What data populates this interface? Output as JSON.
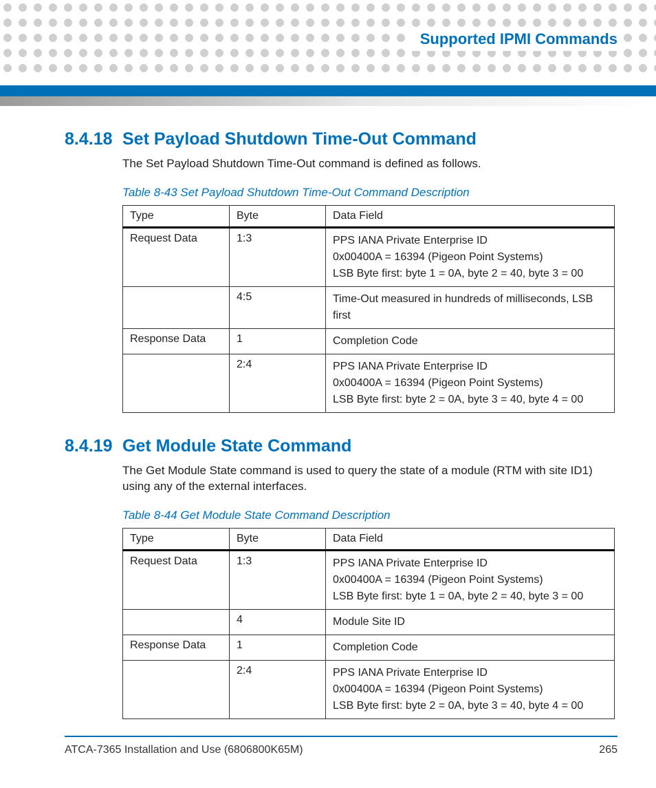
{
  "header": {
    "title": "Supported IPMI Commands"
  },
  "sections": [
    {
      "number": "8.4.18",
      "title": "Set Payload Shutdown Time-Out Command",
      "intro": "The Set Payload Shutdown Time-Out command is defined as follows.",
      "table_caption": "Table 8-43 Set Payload Shutdown Time-Out Command Description",
      "table": {
        "headers": [
          "Type",
          "Byte",
          "Data Field"
        ],
        "rows": [
          {
            "type": "Request Data",
            "byte": "1:3",
            "data": "PPS IANA Private Enterprise ID\n0x00400A = 16394 (Pigeon Point Systems)\nLSB Byte first: byte 1 = 0A, byte 2 = 40, byte 3 = 00"
          },
          {
            "type": "",
            "byte": "4:5",
            "data": "Time-Out measured in hundreds of milliseconds, LSB first"
          },
          {
            "type": "Response Data",
            "byte": "1",
            "data": "Completion Code"
          },
          {
            "type": "",
            "byte": "2:4",
            "data": "PPS IANA Private Enterprise ID\n0x00400A = 16394 (Pigeon Point Systems)\nLSB Byte first: byte 2 = 0A, byte 3 = 40, byte 4 = 00"
          }
        ]
      }
    },
    {
      "number": "8.4.19",
      "title": "Get Module State Command",
      "intro": "The Get Module State command is used to query the state of a module (RTM with site ID1) using any of the external interfaces.",
      "table_caption": "Table 8-44 Get Module State Command Description",
      "table": {
        "headers": [
          "Type",
          "Byte",
          "Data Field"
        ],
        "rows": [
          {
            "type": "Request Data",
            "byte": "1:3",
            "data": "PPS IANA Private Enterprise ID\n0x00400A = 16394 (Pigeon Point Systems)\nLSB Byte first: byte 1 = 0A, byte 2 = 40, byte 3 = 00"
          },
          {
            "type": "",
            "byte": "4",
            "data": "Module Site ID"
          },
          {
            "type": "Response Data",
            "byte": "1",
            "data": "Completion Code"
          },
          {
            "type": "",
            "byte": "2:4",
            "data": "PPS IANA Private Enterprise ID\n0x00400A = 16394 (Pigeon Point Systems)\nLSB Byte first: byte 2 = 0A, byte 3 = 40, byte 4 = 00"
          }
        ]
      }
    }
  ],
  "footer": {
    "doc": "ATCA-7365 Installation and Use (6806800K65M)",
    "page": "265"
  }
}
